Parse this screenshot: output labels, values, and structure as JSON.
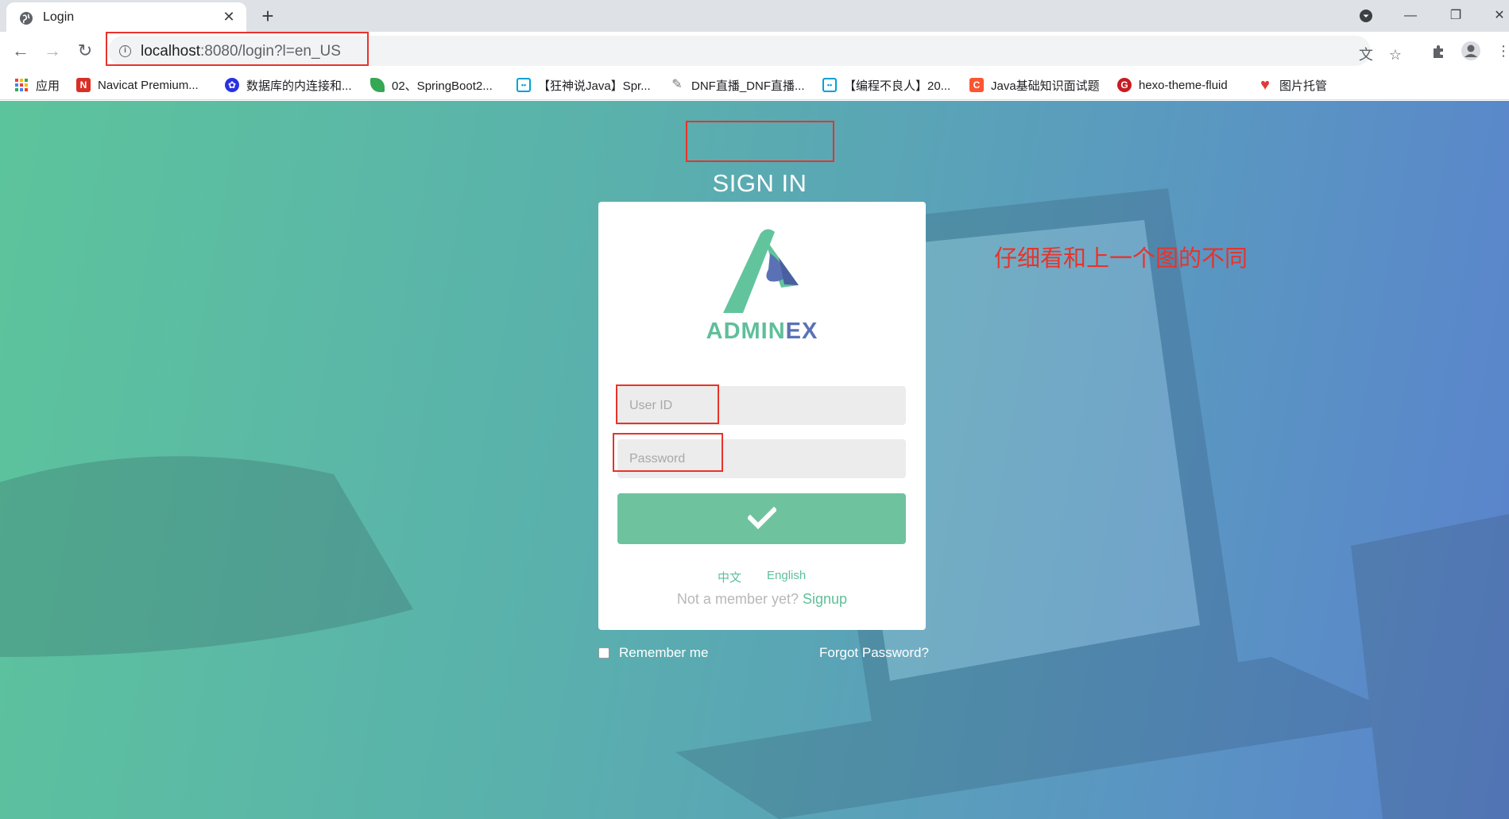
{
  "tab": {
    "title": "Login"
  },
  "address_bar": {
    "url_host": "localhost",
    "url_rest": ":8080/login?l=en_US"
  },
  "bookmarks": [
    {
      "label": "应用",
      "icon": "apps-grid-icon",
      "color": "#4285f4"
    },
    {
      "label": "Navicat Premium...",
      "icon": "navicat-icon",
      "color": "#d93025"
    },
    {
      "label": "数据库的内连接和...",
      "icon": "baidu-paw-icon",
      "color": "#2932e1"
    },
    {
      "label": "02、SpringBoot2...",
      "icon": "leaf-icon",
      "color": "#34a853"
    },
    {
      "label": "【狂神说Java】Spr...",
      "icon": "bilibili-icon",
      "color": "#00a1d6"
    },
    {
      "label": "DNF直播_DNF直播...",
      "icon": "feather-icon",
      "color": "#777777"
    },
    {
      "label": "【编程不良人】20...",
      "icon": "bilibili-icon",
      "color": "#00a1d6"
    },
    {
      "label": "Java基础知识面试题",
      "icon": "csdn-icon",
      "color": "#fc5531"
    },
    {
      "label": "hexo-theme-fluid",
      "icon": "gitee-icon",
      "color": "#c71d23"
    },
    {
      "label": "图片托管",
      "icon": "heart-icon",
      "color": "#e53935"
    }
  ],
  "login": {
    "heading": "SIGN IN",
    "logo_text_a": "ADMIN",
    "logo_text_b": "EX",
    "userid_placeholder": "User ID",
    "password_placeholder": "Password",
    "lang_zh": "中文",
    "lang_en": "English",
    "member_text": "Not a member yet?",
    "signup": "Signup",
    "remember": "Remember me",
    "forgot": "Forgot Password?"
  },
  "annotation": "仔细看和上一个图的不同",
  "colors": {
    "accent": "#5ebf9a",
    "brand_blue": "#5a72b5",
    "annotation_red": "#e8332b"
  }
}
